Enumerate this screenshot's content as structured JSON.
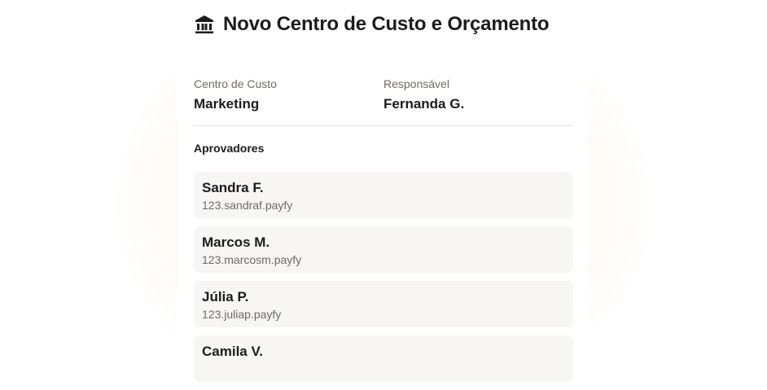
{
  "header": {
    "title": "Novo Centro de Custo e Orçamento",
    "icon": "bank-icon"
  },
  "info": {
    "cost_center_label": "Centro de Custo",
    "cost_center_value": "Marketing",
    "owner_label": "Responsável",
    "owner_value": "Fernanda G."
  },
  "approvers": {
    "title": "Aprovadores",
    "items": [
      {
        "name": "Sandra F.",
        "key": "123.sandraf.payfy"
      },
      {
        "name": "Marcos M.",
        "key": "123.marcosm.payfy"
      },
      {
        "name": "Júlia P.",
        "key": "123.juliap.payfy"
      },
      {
        "name": "Camila V.",
        "key": ""
      }
    ]
  },
  "colors": {
    "text": "#1c1c1c",
    "muted": "#6f6a66",
    "item_bg": "#f7f6f5",
    "glow": "#ffc896"
  }
}
